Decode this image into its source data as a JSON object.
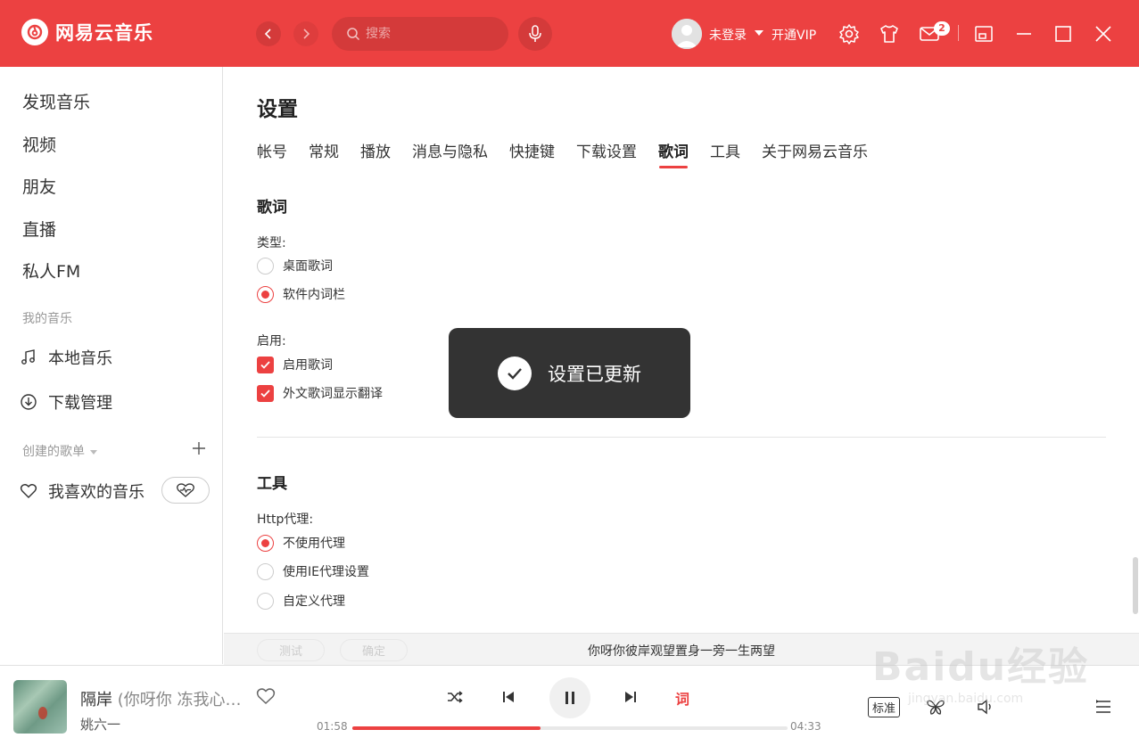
{
  "app": {
    "name": "网易云音乐",
    "search_placeholder": "搜索",
    "user": "未登录",
    "vip": "开通VIP",
    "mail_badge": "2"
  },
  "sidebar": {
    "main_items": [
      "发现音乐",
      "视频",
      "朋友",
      "直播",
      "私人FM"
    ],
    "my_music_title": "我的音乐",
    "my_music_items": [
      "本地音乐",
      "下载管理"
    ],
    "playlists_title": "创建的歌单",
    "liked": "我喜欢的音乐"
  },
  "settings": {
    "title": "设置",
    "tabs": [
      "帐号",
      "常规",
      "播放",
      "消息与隐私",
      "快捷键",
      "下载设置",
      "歌词",
      "工具",
      "关于网易云音乐"
    ],
    "active_tab": "歌词",
    "lyrics": {
      "title": "歌词",
      "type_label": "类型:",
      "type_options": [
        "桌面歌词",
        "软件内词栏"
      ],
      "type_selected": "软件内词栏",
      "enable_label": "启用:",
      "enable_options": [
        "启用歌词",
        "外文歌词显示翻译"
      ]
    },
    "tools": {
      "title": "工具",
      "proxy_label": "Http代理:",
      "proxy_options": [
        "不使用代理",
        "使用IE代理设置",
        "自定义代理"
      ],
      "proxy_selected": "不使用代理",
      "test_button": "测试",
      "confirm_button": "确定"
    }
  },
  "toast": {
    "message": "设置已更新"
  },
  "lyric_strip": {
    "text": "你呀你彼岸观望置身一旁一生两望"
  },
  "player": {
    "song_title": "隔岸",
    "song_subtitle": "(你呀你 冻我心…",
    "artist": "姚六一",
    "lyric_button": "词",
    "time_current": "01:58",
    "time_total": "04:33",
    "progress_fraction": 0.432,
    "quality": "标准"
  },
  "watermark": {
    "text": "Baidu经验",
    "url": "jingyan.baidu.com"
  },
  "colors": {
    "brand": "#ec4141"
  }
}
